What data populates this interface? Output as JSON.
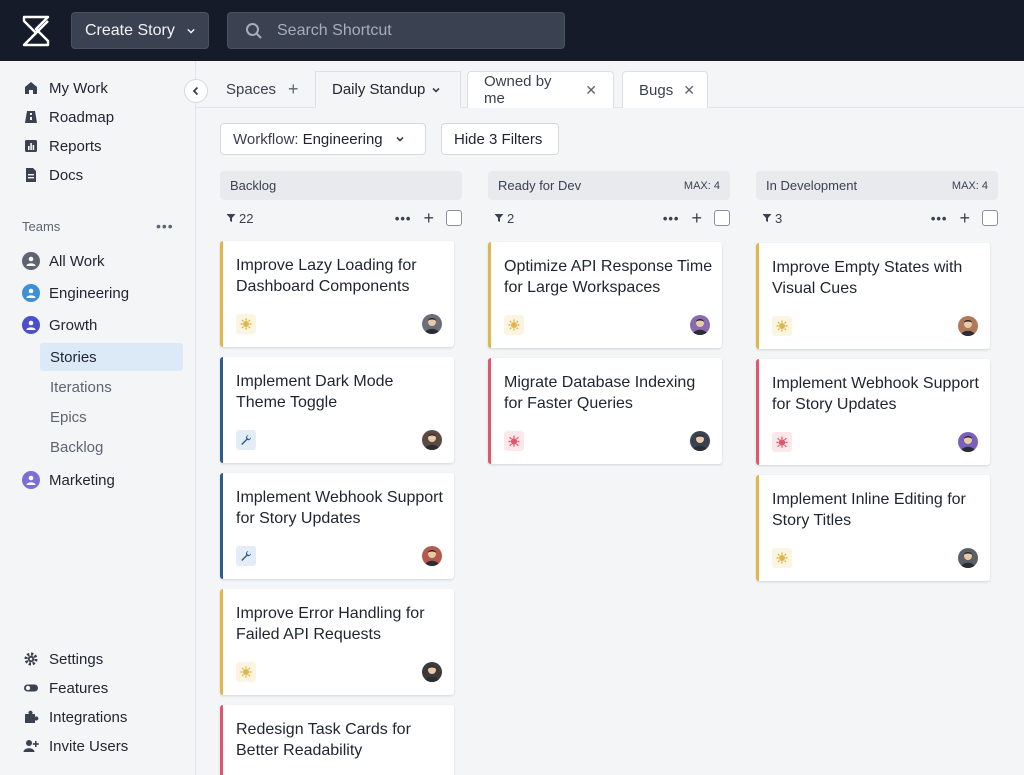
{
  "topbar": {
    "create_label": "Create Story",
    "search_placeholder": "Search Shortcut"
  },
  "sidebar": {
    "nav": [
      {
        "label": "My Work",
        "icon": "home-icon"
      },
      {
        "label": "Roadmap",
        "icon": "roadmap-icon"
      },
      {
        "label": "Reports",
        "icon": "reports-icon"
      },
      {
        "label": "Docs",
        "icon": "docs-icon"
      }
    ],
    "teams_label": "Teams",
    "teams": [
      {
        "label": "All Work"
      },
      {
        "label": "Engineering"
      },
      {
        "label": "Growth"
      }
    ],
    "growth_sub": [
      "Stories",
      "Iterations",
      "Epics",
      "Backlog"
    ],
    "marketing_label": "Marketing",
    "bottom": [
      {
        "label": "Settings",
        "icon": "gear-icon"
      },
      {
        "label": "Features",
        "icon": "toggle-icon"
      },
      {
        "label": "Integrations",
        "icon": "puzzle-icon"
      },
      {
        "label": "Invite Users",
        "icon": "add-user-icon"
      }
    ]
  },
  "tabs": {
    "spaces": "Spaces",
    "daily": "Daily Standup",
    "owned": "Owned by me",
    "bugs": "Bugs"
  },
  "filters": {
    "workflow_prefix": "Workflow:",
    "workflow_value": "Engineering",
    "hide_filters": "Hide 3 Filters"
  },
  "columns": [
    {
      "name": "Backlog",
      "max": "",
      "count": "22"
    },
    {
      "name": "Ready for Dev",
      "max": "MAX: 4",
      "count": "2"
    },
    {
      "name": "In Development",
      "max": "MAX: 4",
      "count": "3"
    }
  ],
  "cards": {
    "backlog": [
      {
        "title": "Improve Lazy Loading for Dashboard Components",
        "type": "feature"
      },
      {
        "title": "Implement Dark Mode Theme Toggle",
        "type": "chore"
      },
      {
        "title": "Implement Webhook Support for Story Updates",
        "type": "chore"
      },
      {
        "title": "Improve Error Handling for Failed API Requests",
        "type": "feature"
      },
      {
        "title": "Redesign Task Cards for Better Readability",
        "type": "bug"
      }
    ],
    "ready": [
      {
        "title": "Optimize API Response Time for Large Workspaces",
        "type": "feature"
      },
      {
        "title": "Migrate Database Indexing for Faster Queries",
        "type": "bug"
      }
    ],
    "dev": [
      {
        "title": "Improve Empty States with Visual Cues",
        "type": "feature"
      },
      {
        "title": "Implement Webhook Support for Story Updates",
        "type": "bug"
      },
      {
        "title": "Implement Inline Editing for Story Titles",
        "type": "feature"
      }
    ]
  },
  "colors": {
    "feature": "#e0b64a",
    "chore": "#2f5c8a",
    "bug": "#e0566b",
    "topbar": "#161b2a"
  }
}
